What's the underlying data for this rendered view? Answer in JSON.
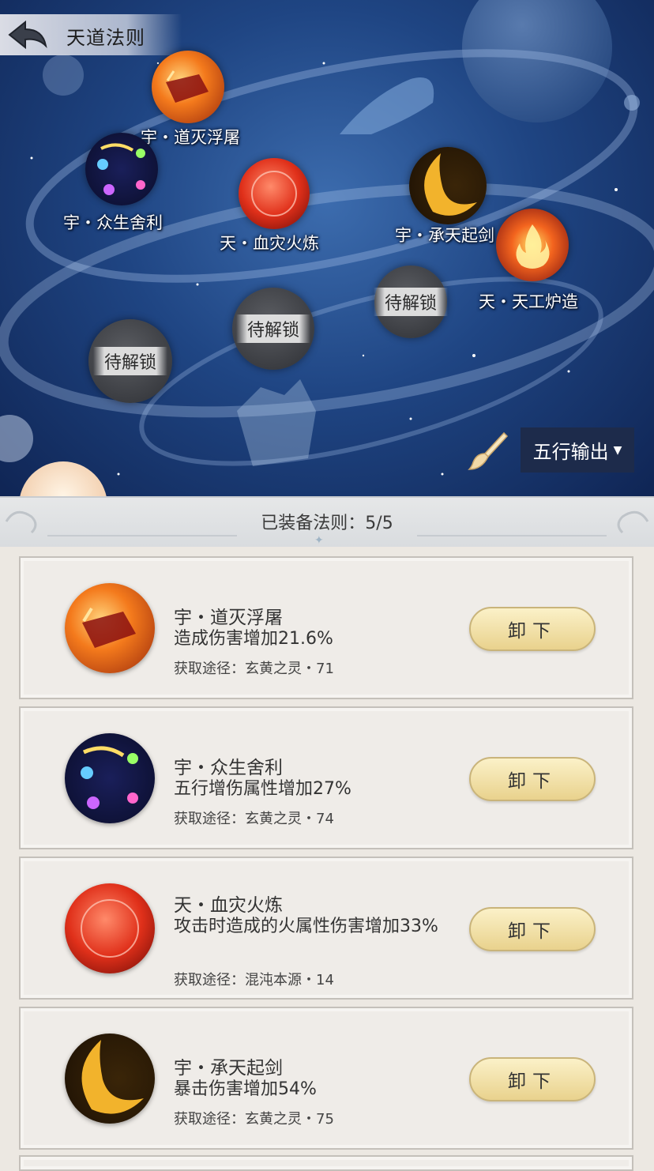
{
  "header": {
    "title": "天道法则"
  },
  "map_nodes": [
    {
      "label": "宇・道灭浮屠",
      "icon": "crimson-dragon-icon"
    },
    {
      "label": "宇・众生舍利",
      "icon": "rainbow-orb-icon"
    },
    {
      "label": "天・血灾火炼",
      "icon": "red-sphere-icon"
    },
    {
      "label": "宇・承天起剑",
      "icon": "golden-crescent-icon"
    },
    {
      "label": "天・天工炉造",
      "icon": "flame-icon"
    }
  ],
  "locked_nodes": [
    {
      "label": "待解锁"
    },
    {
      "label": "待解锁"
    },
    {
      "label": "待解锁"
    }
  ],
  "filter": {
    "selected": "五行输出"
  },
  "panel": {
    "equipped_count": "已装备法则：5/5"
  },
  "equipped": [
    {
      "name": "宇・道灭浮屠",
      "effect": "造成伤害增加21.6%",
      "source": "获取途径：玄黄之灵・71",
      "button": "卸下"
    },
    {
      "name": "宇・众生舍利",
      "effect": "五行增伤属性增加27%",
      "source": "获取途径：玄黄之灵・74",
      "button": "卸下"
    },
    {
      "name": "天・血灾火炼",
      "effect": "攻击时造成的火属性伤害增加33%",
      "source": "获取途径：混沌本源・14",
      "button": "卸下"
    },
    {
      "name": "宇・承天起剑",
      "effect": "暴击伤害增加54%",
      "source": "获取途径：玄黄之灵・75",
      "button": "卸下"
    }
  ],
  "colors": {
    "button_gold": "#e9d28d",
    "dropdown_bg": "#1d2b4b",
    "sky": "#1f4583"
  }
}
